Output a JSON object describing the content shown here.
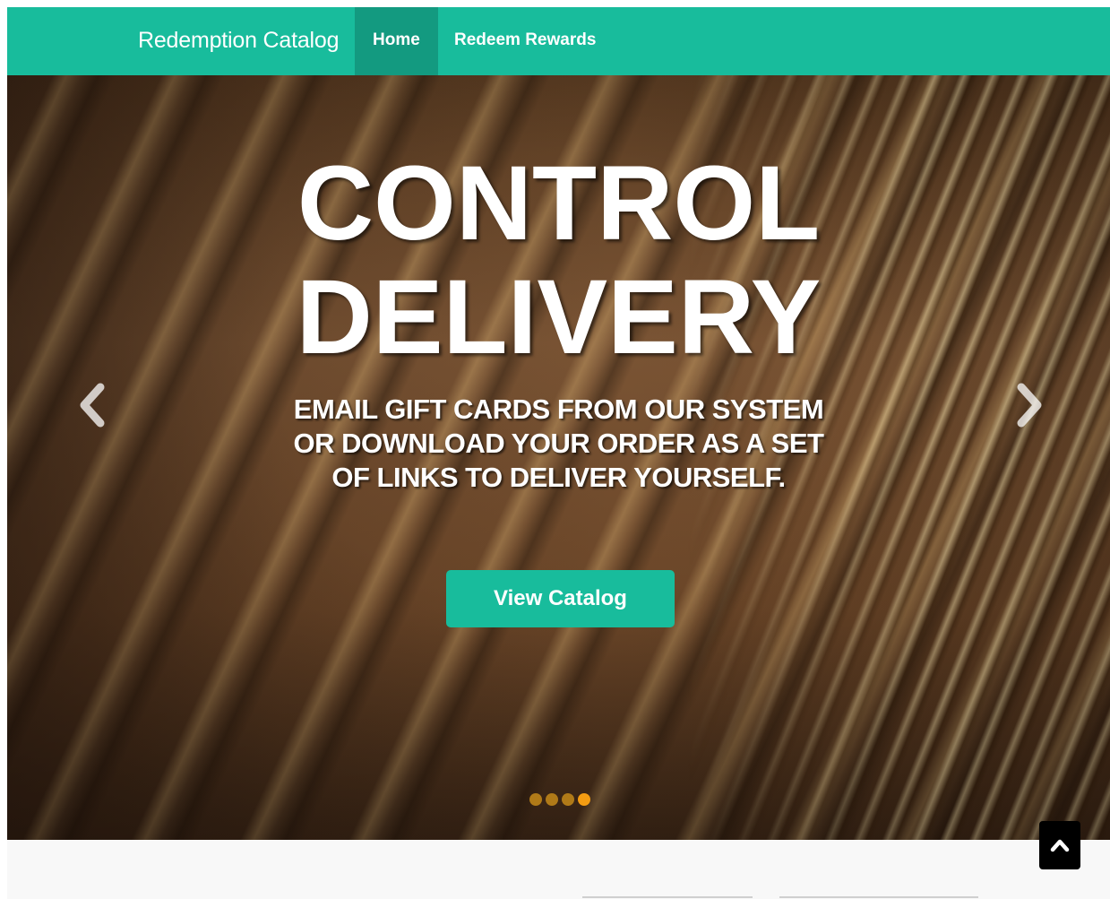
{
  "navbar": {
    "brand": "Redemption Catalog",
    "items": [
      {
        "label": "Home",
        "active": true
      },
      {
        "label": "Redeem Rewards",
        "active": false
      }
    ],
    "bg_color": "#18bc9c"
  },
  "hero": {
    "headline_line1": "CONTROL",
    "headline_line2": "DELIVERY",
    "subhead": "Email gift cards from our system or download your order as a set of links to deliver yourself.",
    "cta_label": "View Catalog",
    "prev_icon": "chevron-left-icon",
    "next_icon": "chevron-right-icon",
    "indicators": {
      "count": 4,
      "active_index": 3
    }
  },
  "scroll_top": {
    "icon": "chevron-up-icon"
  },
  "colors": {
    "accent": "#18bc9c",
    "indicator_active": "#f39c12",
    "indicator": "#b07a18"
  }
}
